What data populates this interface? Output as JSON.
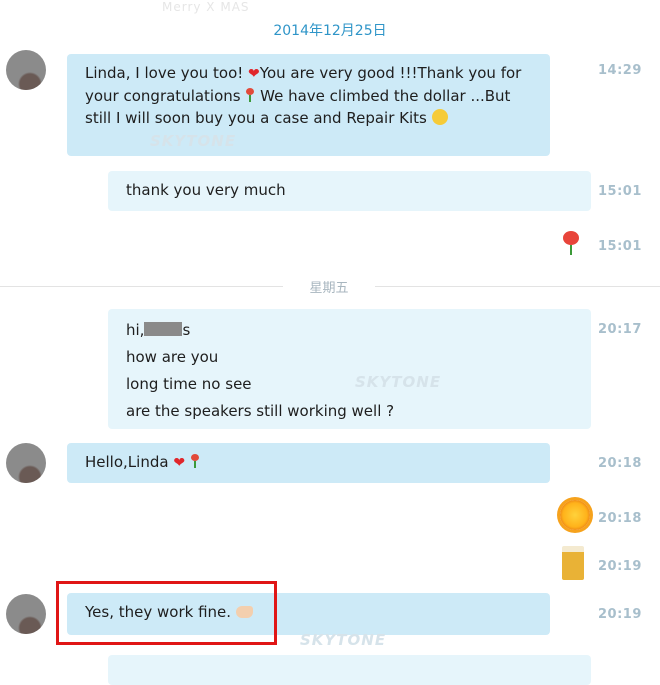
{
  "header": {
    "faded_text": "Merry X MAS",
    "date": "2014年12月25日"
  },
  "divider": {
    "label": "星期五"
  },
  "watermark": "SKYTONE",
  "messages": [
    {
      "side": "in",
      "lines": [
        "Linda, I love you too! ",
        "You are very good !!!Thank you for your congratulations ",
        " We have climbed the dollar ...But still I will soon buy you a case and Repair Kits "
      ],
      "time": "14:29"
    },
    {
      "side": "out",
      "text": "thank you very much",
      "time": "15:01"
    },
    {
      "side": "out",
      "type": "sticker",
      "sticker": "flower-icon",
      "time": "15:01"
    },
    {
      "side": "out",
      "lines": [
        "hi,",
        "s",
        "how are you",
        "long time no see",
        "are the speakers still working well ?"
      ],
      "time": "20:17"
    },
    {
      "side": "in",
      "text": "Hello,Linda ",
      "time": "20:18"
    },
    {
      "side": "out",
      "type": "sticker",
      "sticker": "sun-face-icon",
      "time": "20:18"
    },
    {
      "side": "out",
      "type": "sticker",
      "sticker": "beer-mug-icon",
      "time": "20:19"
    },
    {
      "side": "in",
      "text": "Yes, they work fine. ",
      "time": "20:19"
    }
  ],
  "colors": {
    "incoming_bubble": "#cdeaf7",
    "outgoing_bubble": "#e6f5fb",
    "time": "#a8bfcc",
    "date": "#2f95c8",
    "highlight": "#e01616"
  }
}
